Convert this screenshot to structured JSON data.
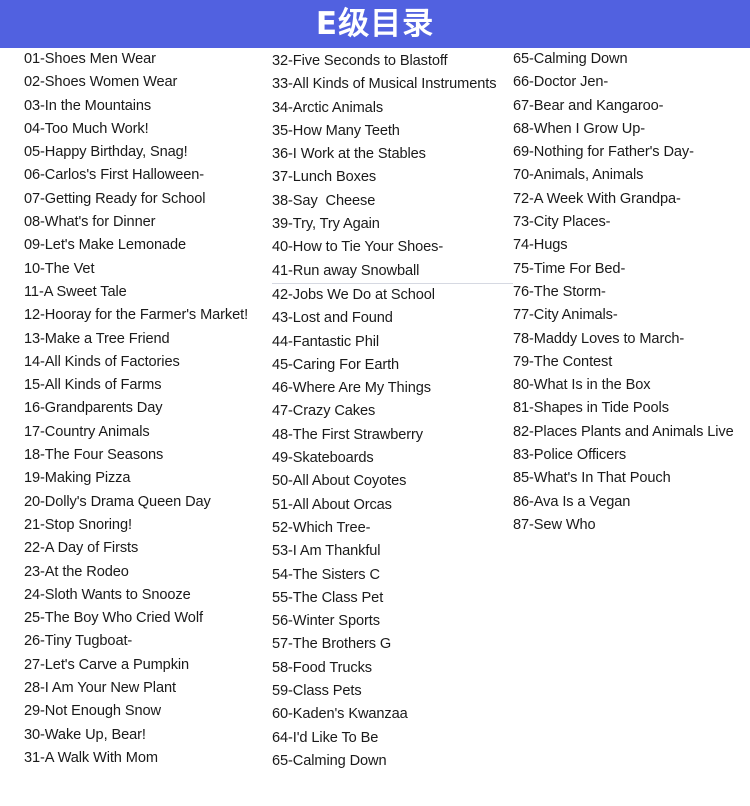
{
  "header": {
    "title": "E级目录",
    "background_color": "#5161E0",
    "text_color": "#ffffff"
  },
  "catalog": {
    "text_color": "#1a1a1a",
    "rule_color": "#d6d9e2",
    "columns": [
      {
        "name": "column-1",
        "entries": [
          {
            "text": "01-Shoes Men Wear",
            "ruled": false
          },
          {
            "text": "02-Shoes Women Wear",
            "ruled": false
          },
          {
            "text": "03-In the Mountains",
            "ruled": false
          },
          {
            "text": "04-Too Much Work!",
            "ruled": false
          },
          {
            "text": "05-Happy Birthday, Snag!",
            "ruled": false
          },
          {
            "text": "06-Carlos's First Halloween-",
            "ruled": false
          },
          {
            "text": "07-Getting Ready for School",
            "ruled": false
          },
          {
            "text": "08-What's for Dinner",
            "ruled": false
          },
          {
            "text": "09-Let's Make Lemonade",
            "ruled": false
          },
          {
            "text": "10-The Vet",
            "ruled": false
          },
          {
            "text": "11-A Sweet Tale",
            "ruled": false
          },
          {
            "text": "12-Hooray for the Farmer's Market!",
            "ruled": false
          },
          {
            "text": "13-Make a Tree Friend",
            "ruled": false
          },
          {
            "text": "14-All Kinds of Factories",
            "ruled": false
          },
          {
            "text": "15-All Kinds of Farms",
            "ruled": false
          },
          {
            "text": "16-Grandparents Day",
            "ruled": false
          },
          {
            "text": "17-Country Animals",
            "ruled": false
          },
          {
            "text": "18-The Four Seasons",
            "ruled": false
          },
          {
            "text": "19-Making Pizza",
            "ruled": false
          },
          {
            "text": "20-Dolly's Drama Queen Day",
            "ruled": false
          },
          {
            "text": "21-Stop Snoring!",
            "ruled": false
          },
          {
            "text": "22-A Day of Firsts",
            "ruled": false
          },
          {
            "text": "23-At the Rodeo",
            "ruled": false
          },
          {
            "text": "24-Sloth Wants to Snooze",
            "ruled": false
          },
          {
            "text": "25-The Boy Who Cried Wolf",
            "ruled": false
          },
          {
            "text": "26-Tiny Tugboat-",
            "ruled": false
          },
          {
            "text": "27-Let's Carve a Pumpkin",
            "ruled": false
          },
          {
            "text": "28-I Am Your New Plant",
            "ruled": false
          },
          {
            "text": "29-Not Enough Snow",
            "ruled": false
          },
          {
            "text": "30-Wake Up, Bear!",
            "ruled": false
          },
          {
            "text": "31-A Walk With Mom",
            "ruled": false
          }
        ]
      },
      {
        "name": "column-2",
        "entries": [
          {
            "text": "32-Five Seconds to Blastoff",
            "ruled": false
          },
          {
            "text": "33-All Kinds of Musical Instruments",
            "ruled": false
          },
          {
            "text": "34-Arctic Animals",
            "ruled": false
          },
          {
            "text": "35-How Many Teeth",
            "ruled": false
          },
          {
            "text": "36-I Work at the Stables",
            "ruled": false
          },
          {
            "text": "37-Lunch Boxes",
            "ruled": false
          },
          {
            "text": "38-Say  Cheese",
            "ruled": false
          },
          {
            "text": "39-Try, Try Again",
            "ruled": false
          },
          {
            "text": "40-How to Tie Your Shoes-",
            "ruled": false
          },
          {
            "text": "41-Run away Snowball",
            "ruled": true
          },
          {
            "text": "42-Jobs We Do at School",
            "ruled": false
          },
          {
            "text": "43-Lost and Found",
            "ruled": false
          },
          {
            "text": "44-Fantastic Phil",
            "ruled": false
          },
          {
            "text": "45-Caring For Earth",
            "ruled": false
          },
          {
            "text": "46-Where Are My Things",
            "ruled": false
          },
          {
            "text": "47-Crazy Cakes",
            "ruled": false
          },
          {
            "text": "48-The First Strawberry",
            "ruled": false
          },
          {
            "text": "49-Skateboards",
            "ruled": false
          },
          {
            "text": "50-All About Coyotes",
            "ruled": false
          },
          {
            "text": "51-All About Orcas",
            "ruled": false
          },
          {
            "text": "52-Which Tree-",
            "ruled": false
          },
          {
            "text": "53-I Am Thankful",
            "ruled": false
          },
          {
            "text": "54-The Sisters C",
            "ruled": false
          },
          {
            "text": "55-The Class Pet",
            "ruled": false
          },
          {
            "text": "56-Winter Sports",
            "ruled": false
          },
          {
            "text": "57-The Brothers G",
            "ruled": false
          },
          {
            "text": "58-Food Trucks",
            "ruled": false
          },
          {
            "text": "59-Class Pets",
            "ruled": false
          },
          {
            "text": "60-Kaden's Kwanzaa",
            "ruled": false
          },
          {
            "text": "64-I'd Like To Be",
            "ruled": false
          },
          {
            "text": "65-Calming Down",
            "ruled": false
          }
        ]
      },
      {
        "name": "column-3",
        "entries": [
          {
            "text": "65-Calming Down",
            "ruled": false
          },
          {
            "text": "66-Doctor Jen-",
            "ruled": false
          },
          {
            "text": "67-Bear and Kangaroo-",
            "ruled": false
          },
          {
            "text": "68-When I Grow Up-",
            "ruled": false
          },
          {
            "text": "69-Nothing for Father's Day-",
            "ruled": false
          },
          {
            "text": "70-Animals, Animals",
            "ruled": false
          },
          {
            "text": "72-A Week With Grandpa-",
            "ruled": false
          },
          {
            "text": "73-City Places-",
            "ruled": false
          },
          {
            "text": "74-Hugs",
            "ruled": false
          },
          {
            "text": "75-Time For Bed-",
            "ruled": false
          },
          {
            "text": "76-The Storm-",
            "ruled": false
          },
          {
            "text": "77-City Animals-",
            "ruled": false
          },
          {
            "text": "78-Maddy Loves to March-",
            "ruled": false
          },
          {
            "text": "79-The Contest",
            "ruled": false
          },
          {
            "text": "80-What Is in the Box",
            "ruled": false
          },
          {
            "text": "81-Shapes in Tide Pools",
            "ruled": false
          },
          {
            "text": "82-Places Plants and Animals Live",
            "ruled": false
          },
          {
            "text": "83-Police Officers",
            "ruled": false
          },
          {
            "text": "85-What's In That Pouch",
            "ruled": false
          },
          {
            "text": "86-Ava Is a Vegan",
            "ruled": false
          },
          {
            "text": "87-Sew Who",
            "ruled": false
          }
        ]
      }
    ]
  }
}
